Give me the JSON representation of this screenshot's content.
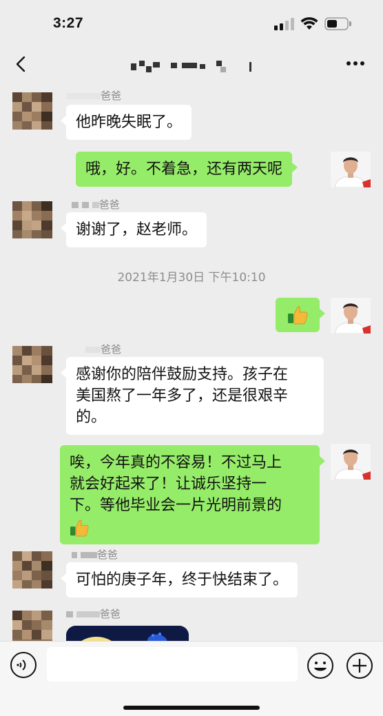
{
  "status_bar": {
    "time": "3:27"
  },
  "nav": {
    "back_icon": "chevron-left-icon",
    "more_icon": "more-dots-icon"
  },
  "messages": [
    {
      "sender_suffix": "爸爸",
      "text": "他昨晚失眠了。"
    },
    {
      "text": "哦，好。不着急，还有两天呢"
    },
    {
      "sender_suffix": "爸爸",
      "text": "谢谢了，赵老师。"
    },
    {
      "timestamp": "2021年1月30日 下午10:10"
    },
    {
      "icon": "thumbs-up-icon"
    },
    {
      "sender_suffix": "爸爸",
      "text_line1": "感谢你的陪伴鼓励支持。孩子在",
      "text_line2": "美国熬了一年多了，还是很艰辛",
      "text_line3": "的。"
    },
    {
      "text_line1": "唉，今年真的不容易！不过马上",
      "text_line2": "就会好起来了！让诚乐坚持一",
      "text_line3": "下。等他毕业会一片光明前景的"
    },
    {
      "sender_suffix": "爸爸",
      "text": "可怕的庚子年，终于快结束了。"
    },
    {
      "sender_suffix": "爸爸",
      "image": "image-message"
    }
  ],
  "input_bar": {
    "voice_icon": "voice-icon",
    "emoji_icon": "emoji-icon",
    "plus_icon": "plus-icon"
  },
  "colors": {
    "background": "#ededed",
    "outgoing_bubble": "#95ec69",
    "incoming_bubble": "#ffffff"
  }
}
